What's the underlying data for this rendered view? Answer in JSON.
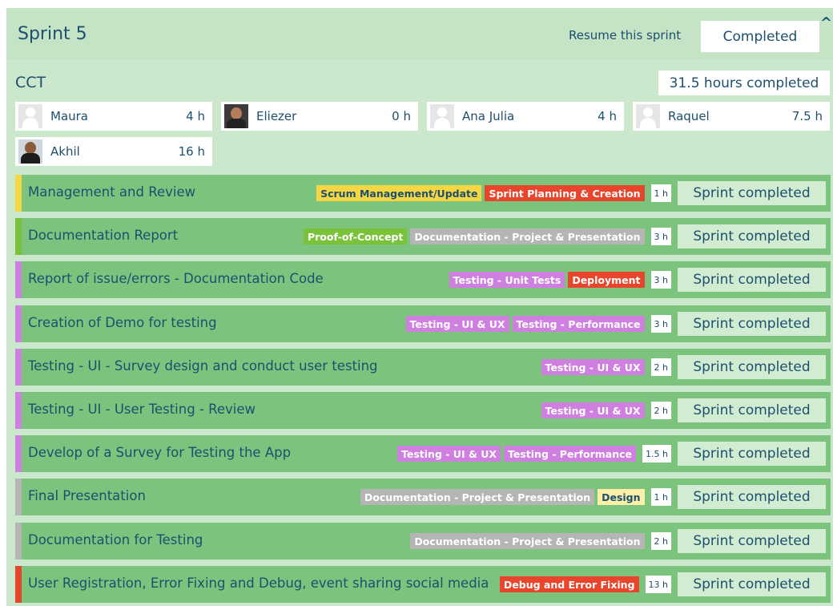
{
  "sprint": {
    "title": "Sprint 5",
    "resume_label": "Resume this sprint",
    "completed_label": "Completed",
    "collapse_icon": "chevron-up-icon"
  },
  "project": {
    "name": "CCT",
    "hours_completed": "31.5 hours completed"
  },
  "members": [
    {
      "name": "Maura",
      "hours": "4 h",
      "avatar": "placeholder"
    },
    {
      "name": "Eliezer",
      "hours": "0 h",
      "avatar": "photo"
    },
    {
      "name": "Ana Julia",
      "hours": "4 h",
      "avatar": "placeholder"
    },
    {
      "name": "Raquel",
      "hours": "7.5 h",
      "avatar": "placeholder"
    },
    {
      "name": "Akhil",
      "hours": "16 h",
      "avatar": "photo"
    }
  ],
  "colors": {
    "yellow": "#f6d743",
    "green": "#79c23a",
    "violet": "#cf7fe0",
    "gray": "#b5b5b5",
    "red": "#e8452c",
    "lightyellow": "#fbf0a6",
    "task_bg": "#7cc47e"
  },
  "tasks": [
    {
      "name": "Management and Review",
      "stripe": "yellow",
      "tags": [
        {
          "label": "Scrum Management/Update",
          "color": "yellow",
          "text": "#1d4f6e"
        },
        {
          "label": "Sprint Planning & Creation",
          "color": "red",
          "text": "#ffffff"
        }
      ],
      "hours": "1 h",
      "status": "Sprint completed"
    },
    {
      "name": "Documentation Report",
      "stripe": "green",
      "tags": [
        {
          "label": "Proof-of-Concept",
          "color": "green",
          "text": "#ffffff"
        },
        {
          "label": "Documentation - Project & Presentation",
          "color": "gray",
          "text": "#ffffff"
        }
      ],
      "hours": "3 h",
      "status": "Sprint completed"
    },
    {
      "name": "Report of  issue/errors - Documentation Code",
      "stripe": "violet",
      "tags": [
        {
          "label": "Testing - Unit Tests",
          "color": "violet",
          "text": "#ffffff"
        },
        {
          "label": "Deployment",
          "color": "red",
          "text": "#ffffff"
        }
      ],
      "hours": "3 h",
      "status": "Sprint completed"
    },
    {
      "name": "Creation of Demo for testing",
      "stripe": "violet",
      "tags": [
        {
          "label": "Testing - UI & UX",
          "color": "violet",
          "text": "#ffffff"
        },
        {
          "label": "Testing - Performance",
          "color": "violet",
          "text": "#ffffff"
        }
      ],
      "hours": "3 h",
      "status": "Sprint completed"
    },
    {
      "name": "Testing - UI - Survey design and conduct user testing",
      "stripe": "violet",
      "tags": [
        {
          "label": "Testing - UI & UX",
          "color": "violet",
          "text": "#ffffff"
        }
      ],
      "hours": "2 h",
      "status": "Sprint completed"
    },
    {
      "name": "Testing - UI - User Testing - Review",
      "stripe": "violet",
      "tags": [
        {
          "label": "Testing - UI & UX",
          "color": "violet",
          "text": "#ffffff"
        }
      ],
      "hours": "2 h",
      "status": "Sprint completed"
    },
    {
      "name": "Develop of a Survey for Testing the App",
      "stripe": "violet",
      "tags": [
        {
          "label": "Testing - UI & UX",
          "color": "violet",
          "text": "#ffffff"
        },
        {
          "label": "Testing - Performance",
          "color": "violet",
          "text": "#ffffff"
        }
      ],
      "hours": "1.5 h",
      "status": "Sprint completed"
    },
    {
      "name": "Final Presentation",
      "stripe": "gray",
      "tags": [
        {
          "label": "Documentation - Project & Presentation",
          "color": "gray",
          "text": "#ffffff"
        },
        {
          "label": "Design",
          "color": "lightyellow",
          "text": "#1d4f6e"
        }
      ],
      "hours": "1 h",
      "status": "Sprint completed"
    },
    {
      "name": "Documentation for Testing",
      "stripe": "gray",
      "tags": [
        {
          "label": "Documentation - Project & Presentation",
          "color": "gray",
          "text": "#ffffff"
        }
      ],
      "hours": "2 h",
      "status": "Sprint completed"
    },
    {
      "name": "User Registration, Error Fixing and Debug, event sharing social media",
      "stripe": "red",
      "tags": [
        {
          "label": "Debug and Error Fixing",
          "color": "red",
          "text": "#ffffff"
        }
      ],
      "hours": "13 h",
      "status": "Sprint completed"
    }
  ]
}
